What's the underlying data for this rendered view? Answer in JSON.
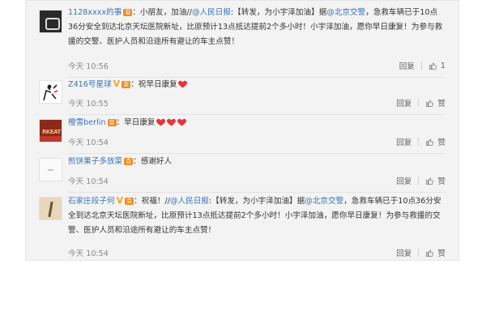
{
  "comments": [
    {
      "name": "1128xxxx的事",
      "segments": [
        {
          "t": "：小朋友，加油//"
        },
        {
          "m": "@人民日报"
        },
        {
          "t": ":【转发，为小宇泽加油】据"
        },
        {
          "m": "@北京交警"
        },
        {
          "t": "，急救车辆已于10点36分安全到达北京天坛医院新址，比原预计13点抵达提前2个多小时！小宇泽加油，愿你早日康复！为参与救援的交警、医护人员和沿途所有避让的车主点赞！"
        }
      ],
      "time": "今天 10:56",
      "reply": "回复",
      "like": "1"
    },
    {
      "name": "Z416号星球",
      "segments": [
        {
          "t": "：祝早日康复"
        }
      ],
      "hearts": 1,
      "time": "今天 10:55",
      "reply": "回复",
      "like": "赞"
    },
    {
      "name": "橙雪berlin",
      "segments": [
        {
          "t": "：早日康复"
        }
      ],
      "hearts": 3,
      "time": "今天 10:54",
      "reply": "回复",
      "like": "赞"
    },
    {
      "name": "煎饼果子多放菜",
      "segments": [
        {
          "t": "：感谢好人"
        }
      ],
      "time": "今天 10:54",
      "reply": "回复",
      "like": "赞"
    },
    {
      "name": "石家庄段子何",
      "segments": [
        {
          "t": "：祝福！//"
        },
        {
          "m": "@人民日报"
        },
        {
          "t": ":【转发，为小宇泽加油】据"
        },
        {
          "m": "@北京交警"
        },
        {
          "t": "，急救车辆已于10点36分安全到达北京天坛医院新址，比原预计13点抵达提前2个多小时！小宇泽加油，愿你早日康复！为参与救援的交警、医护人员和沿途所有避让的车主点赞！"
        }
      ],
      "time": "今天 10:54",
      "reply": "回复",
      "like": "赞"
    }
  ],
  "colors": {
    "link": "#3a73b8",
    "text": "#333333",
    "meta": "#888888",
    "heart": "#e8353a",
    "vip": "#f5a623",
    "badge": "#f08b1d"
  },
  "icons": {
    "like": "thumbs-up-icon",
    "heart": "heart-icon",
    "vip": "vip-v-icon",
    "badge": "member-badge-icon"
  }
}
